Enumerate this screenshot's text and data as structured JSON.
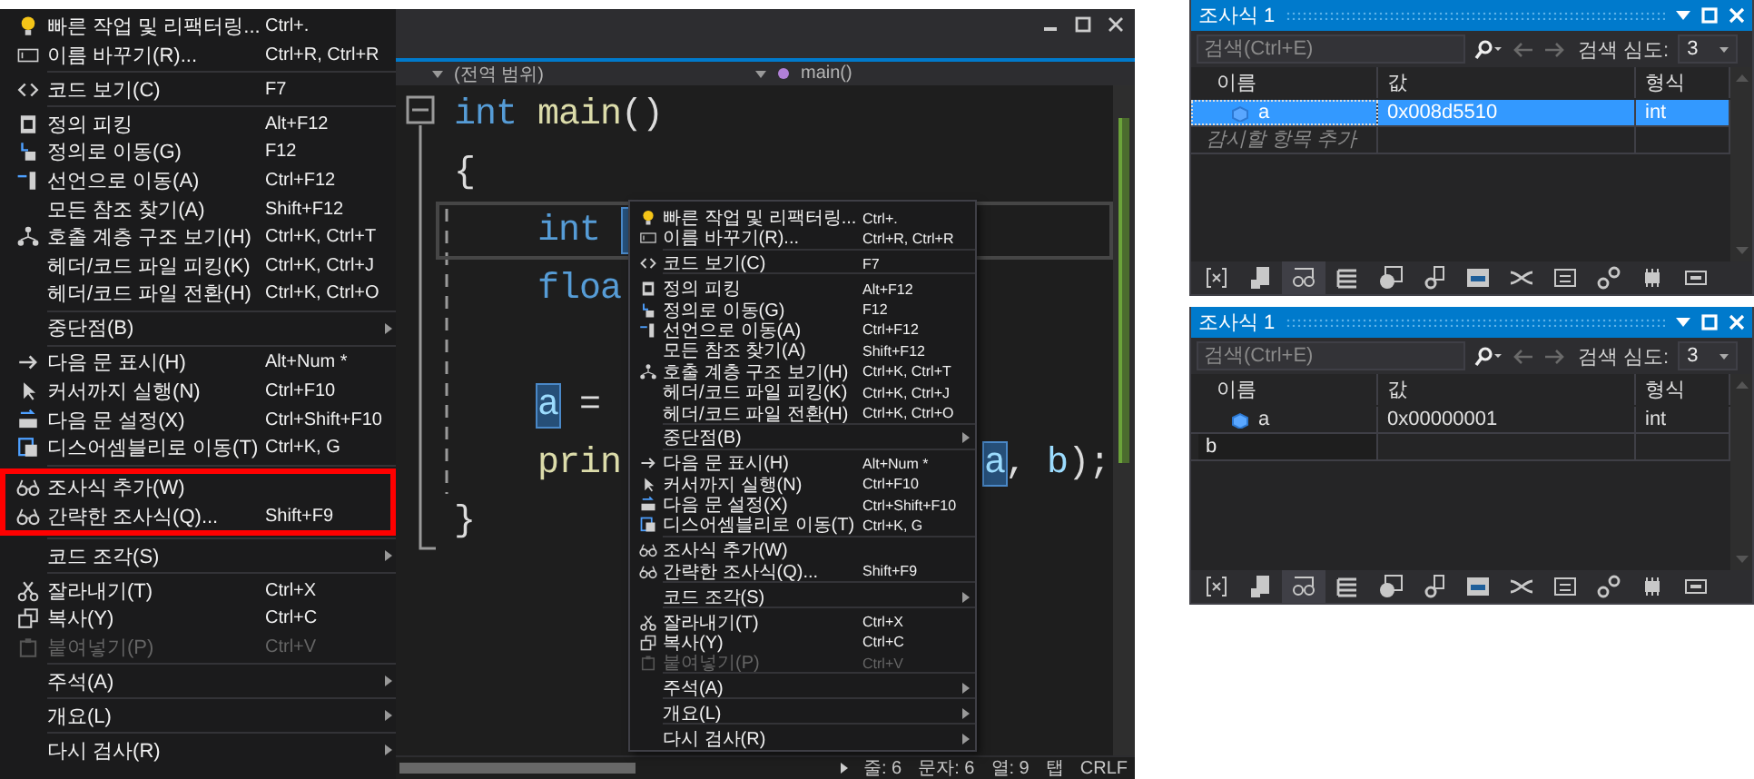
{
  "left_menu": {
    "sections": [
      {
        "outlined": false,
        "items": [
          {
            "kind": "bulb",
            "label": "빠른 작업 및 리팩터링...",
            "shortcut": "Ctrl+.",
            "disabled": false,
            "submenu": false
          },
          {
            "kind": "rename",
            "label": "이름 바꾸기(R)...",
            "shortcut": "Ctrl+R, Ctrl+R",
            "disabled": false,
            "submenu": false
          }
        ]
      },
      {
        "outlined": false,
        "items": [
          {
            "kind": "code",
            "label": "코드 보기(C)",
            "shortcut": "F7",
            "disabled": false,
            "submenu": false
          }
        ]
      },
      {
        "outlined": false,
        "items": [
          {
            "kind": "peek",
            "label": "정의 피킹",
            "shortcut": "Alt+F12",
            "disabled": false,
            "submenu": false
          },
          {
            "kind": "goto",
            "label": "정의로 이동(G)",
            "shortcut": "F12",
            "disabled": false,
            "submenu": false
          },
          {
            "kind": "declaration",
            "label": "선언으로 이동(A)",
            "shortcut": "Ctrl+F12",
            "disabled": false,
            "submenu": false
          },
          {
            "kind": "plain",
            "label": "모든 참조 찾기(A)",
            "shortcut": "Shift+F12",
            "disabled": false,
            "submenu": false
          },
          {
            "kind": "hierarchy",
            "label": "호출 계층 구조 보기(H)",
            "shortcut": "Ctrl+K, Ctrl+T",
            "disabled": false,
            "submenu": false
          },
          {
            "kind": "plain",
            "label": "헤더/코드 파일 피킹(K)",
            "shortcut": "Ctrl+K, Ctrl+J",
            "disabled": false,
            "submenu": false
          },
          {
            "kind": "plain",
            "label": "헤더/코드 파일 전환(H)",
            "shortcut": "Ctrl+K, Ctrl+O",
            "disabled": false,
            "submenu": false
          }
        ]
      },
      {
        "outlined": false,
        "items": [
          {
            "kind": "plain",
            "label": "중단점(B)",
            "disabled": false,
            "submenu": true
          }
        ]
      },
      {
        "outlined": false,
        "items": [
          {
            "kind": "arrow",
            "label": "다음 문 표시(H)",
            "shortcut": "Alt+Num *",
            "disabled": false,
            "submenu": false
          },
          {
            "kind": "cursor",
            "label": "커서까지 실행(N)",
            "shortcut": "Ctrl+F10",
            "disabled": false,
            "submenu": false
          },
          {
            "kind": "setnext",
            "label": "다음 문 설정(X)",
            "shortcut": "Ctrl+Shift+F10",
            "disabled": false,
            "submenu": false
          },
          {
            "kind": "disasm",
            "label": "디스어셈블리로 이동(T)",
            "shortcut": "Ctrl+K, G",
            "disabled": false,
            "submenu": false
          }
        ]
      },
      {
        "outlined": true,
        "items": [
          {
            "kind": "glasses",
            "label": "조사식 추가(W)",
            "disabled": false,
            "submenu": false
          },
          {
            "kind": "glasses",
            "label": "간략한 조사식(Q)...",
            "shortcut": "Shift+F9",
            "disabled": false,
            "submenu": false
          }
        ]
      },
      {
        "outlined": false,
        "items": [
          {
            "kind": "plain",
            "label": "코드 조각(S)",
            "disabled": false,
            "submenu": true
          }
        ]
      },
      {
        "outlined": false,
        "items": [
          {
            "kind": "scissors",
            "label": "잘라내기(T)",
            "shortcut": "Ctrl+X",
            "disabled": false,
            "submenu": false
          },
          {
            "kind": "copy",
            "label": "복사(Y)",
            "shortcut": "Ctrl+C",
            "disabled": false,
            "submenu": false
          },
          {
            "kind": "paste",
            "label": "붙여넣기(P)",
            "shortcut": "Ctrl+V",
            "disabled": true,
            "submenu": false
          }
        ]
      },
      {
        "outlined": false,
        "items": [
          {
            "kind": "plain",
            "label": "주석(A)",
            "disabled": false,
            "submenu": true
          }
        ]
      },
      {
        "outlined": false,
        "items": [
          {
            "kind": "plain",
            "label": "개요(L)",
            "disabled": false,
            "submenu": true
          }
        ]
      },
      {
        "outlined": false,
        "items": [
          {
            "kind": "plain",
            "label": "다시 검사(R)",
            "disabled": false,
            "submenu": true
          }
        ]
      }
    ]
  },
  "editor": {
    "nav": {
      "scope": "(전역 범위)",
      "member": "main()"
    },
    "code_lines": [
      {
        "indented": false,
        "current": false,
        "parts": [
          {
            "text": "int ",
            "kind": "keyword"
          },
          {
            "text": "main",
            "kind": "function"
          },
          {
            "text": "()",
            "kind": "plain"
          }
        ]
      },
      {
        "indented": false,
        "current": false,
        "parts": [
          {
            "text": "{",
            "kind": "plain"
          }
        ]
      },
      {
        "indented": true,
        "current": true,
        "parts": [
          {
            "text": "int",
            "kind": "keyword"
          },
          {
            "kind": "selection_edge"
          }
        ]
      },
      {
        "indented": true,
        "current": false,
        "parts": [
          {
            "text": "floa",
            "kind": "keyword"
          }
        ]
      },
      {
        "indented": true,
        "current": false
      },
      {
        "indented": true,
        "current": false,
        "parts": [
          {
            "text": "a",
            "kind": "selected"
          },
          {
            "text": " =",
            "kind": "plain"
          }
        ]
      },
      {
        "indented": true,
        "current": false,
        "parts": [
          {
            "text": "prin",
            "kind": "function"
          },
          {
            "kind": "hidden"
          },
          {
            "text": "a",
            "kind": "selected"
          },
          {
            "text": ", ",
            "kind": "plain"
          },
          {
            "text": "b",
            "kind": "variable"
          },
          {
            "text": ");",
            "kind": "plain"
          }
        ]
      },
      {
        "indented": false,
        "current": false,
        "parts": [
          {
            "text": "}",
            "kind": "plain"
          }
        ]
      }
    ],
    "context_menu": {
      "sections": [
        {
          "outlined": false,
          "items": [
            {
              "kind": "bulb",
              "label": "빠른 작업 및 리팩터링...",
              "shortcut": "Ctrl+.",
              "disabled": false,
              "submenu": false
            },
            {
              "kind": "rename",
              "label": "이름 바꾸기(R)...",
              "shortcut": "Ctrl+R, Ctrl+R",
              "disabled": false,
              "submenu": false
            }
          ]
        },
        {
          "outlined": false,
          "items": [
            {
              "kind": "code",
              "label": "코드 보기(C)",
              "shortcut": "F7",
              "disabled": false,
              "submenu": false
            }
          ]
        },
        {
          "outlined": false,
          "items": [
            {
              "kind": "peek",
              "label": "정의 피킹",
              "shortcut": "Alt+F12",
              "disabled": false,
              "submenu": false
            },
            {
              "kind": "goto",
              "label": "정의로 이동(G)",
              "shortcut": "F12",
              "disabled": false,
              "submenu": false
            },
            {
              "kind": "declaration",
              "label": "선언으로 이동(A)",
              "shortcut": "Ctrl+F12",
              "disabled": false,
              "submenu": false
            },
            {
              "kind": "plain",
              "label": "모든 참조 찾기(A)",
              "shortcut": "Shift+F12",
              "disabled": false,
              "submenu": false
            },
            {
              "kind": "hierarchy",
              "label": "호출 계층 구조 보기(H)",
              "shortcut": "Ctrl+K, Ctrl+T",
              "disabled": false,
              "submenu": false
            },
            {
              "kind": "plain",
              "label": "헤더/코드 파일 피킹(K)",
              "shortcut": "Ctrl+K, Ctrl+J",
              "disabled": false,
              "submenu": false
            },
            {
              "kind": "plain",
              "label": "헤더/코드 파일 전환(H)",
              "shortcut": "Ctrl+K, Ctrl+O",
              "disabled": false,
              "submenu": false
            }
          ]
        },
        {
          "outlined": false,
          "items": [
            {
              "kind": "plain",
              "label": "중단점(B)",
              "disabled": false,
              "submenu": true
            }
          ]
        },
        {
          "outlined": false,
          "items": [
            {
              "kind": "arrow",
              "label": "다음 문 표시(H)",
              "shortcut": "Alt+Num *",
              "disabled": false,
              "submenu": false
            },
            {
              "kind": "cursor",
              "label": "커서까지 실행(N)",
              "shortcut": "Ctrl+F10",
              "disabled": false,
              "submenu": false
            },
            {
              "kind": "setnext",
              "label": "다음 문 설정(X)",
              "shortcut": "Ctrl+Shift+F10",
              "disabled": false,
              "submenu": false
            },
            {
              "kind": "disasm",
              "label": "디스어셈블리로 이동(T)",
              "shortcut": "Ctrl+K, G",
              "disabled": false,
              "submenu": false
            }
          ]
        },
        {
          "outlined": false,
          "items": [
            {
              "kind": "glasses",
              "label": "조사식 추가(W)",
              "disabled": false,
              "submenu": false
            },
            {
              "kind": "glasses",
              "label": "간략한 조사식(Q)...",
              "shortcut": "Shift+F9",
              "disabled": false,
              "submenu": false
            }
          ]
        },
        {
          "outlined": false,
          "items": [
            {
              "kind": "plain",
              "label": "코드 조각(S)",
              "disabled": false,
              "submenu": true
            }
          ]
        },
        {
          "outlined": false,
          "items": [
            {
              "kind": "scissors",
              "label": "잘라내기(T)",
              "shortcut": "Ctrl+X",
              "disabled": false,
              "submenu": false
            },
            {
              "kind": "copy",
              "label": "복사(Y)",
              "shortcut": "Ctrl+C",
              "disabled": false,
              "submenu": false
            },
            {
              "kind": "paste",
              "label": "붙여넣기(P)",
              "shortcut": "Ctrl+V",
              "disabled": true,
              "submenu": false
            }
          ]
        },
        {
          "outlined": false,
          "items": [
            {
              "kind": "plain",
              "label": "주석(A)",
              "disabled": false,
              "submenu": true
            }
          ]
        },
        {
          "outlined": false,
          "items": [
            {
              "kind": "plain",
              "label": "개요(L)",
              "disabled": false,
              "submenu": true
            }
          ]
        },
        {
          "outlined": false,
          "items": [
            {
              "kind": "plain",
              "label": "다시 검사(R)",
              "disabled": false,
              "submenu": true
            }
          ]
        }
      ]
    },
    "status": [
      "줄: 6",
      "문자: 6",
      "열: 9",
      "탭",
      "CRLF"
    ]
  },
  "watch_windows": [
    {
      "title": "조사식 1",
      "search": {
        "placeholder": "검색(Ctrl+E)",
        "depth_label": "검색 심도:",
        "depth": "3"
      },
      "columns": [
        "이름",
        "값",
        "형식"
      ],
      "rows": [
        {
          "kind": "variable",
          "name": "a",
          "value": "0x008d5510",
          "type": "int",
          "selected": true
        },
        {
          "kind": "add",
          "placeholder": "감시할 항목 추가"
        }
      ],
      "toolbar": [
        {
          "kind": "brackets",
          "selected": false
        },
        {
          "kind": "document",
          "selected": false
        },
        {
          "kind": "glasses",
          "selected": true
        },
        {
          "kind": "list",
          "selected": false
        },
        {
          "kind": "window",
          "selected": false
        },
        {
          "kind": "gear",
          "selected": false
        },
        {
          "kind": "monitor",
          "selected": false
        },
        {
          "kind": "crossed",
          "selected": false
        },
        {
          "kind": "panel",
          "selected": false
        },
        {
          "kind": "gears",
          "selected": false
        },
        {
          "kind": "chip",
          "selected": false
        },
        {
          "kind": "memory",
          "selected": false
        }
      ]
    },
    {
      "title": "조사식 1",
      "search": {
        "placeholder": "검색(Ctrl+E)",
        "depth_label": "검색 심도:",
        "depth": "3"
      },
      "columns": [
        "이름",
        "값",
        "형식"
      ],
      "rows": [
        {
          "kind": "variable",
          "name": "a",
          "value": "0x00000001",
          "type": "int",
          "selected": false
        },
        {
          "kind": "edit",
          "value": "b"
        }
      ],
      "toolbar": [
        {
          "kind": "brackets",
          "selected": false
        },
        {
          "kind": "document",
          "selected": false
        },
        {
          "kind": "glasses",
          "selected": true
        },
        {
          "kind": "list",
          "selected": false
        },
        {
          "kind": "window",
          "selected": false
        },
        {
          "kind": "gear",
          "selected": false
        },
        {
          "kind": "monitor",
          "selected": false
        },
        {
          "kind": "crossed",
          "selected": false
        },
        {
          "kind": "panel",
          "selected": false
        },
        {
          "kind": "gears",
          "selected": false
        },
        {
          "kind": "chip",
          "selected": false
        },
        {
          "kind": "memory",
          "selected": false
        }
      ]
    }
  ]
}
